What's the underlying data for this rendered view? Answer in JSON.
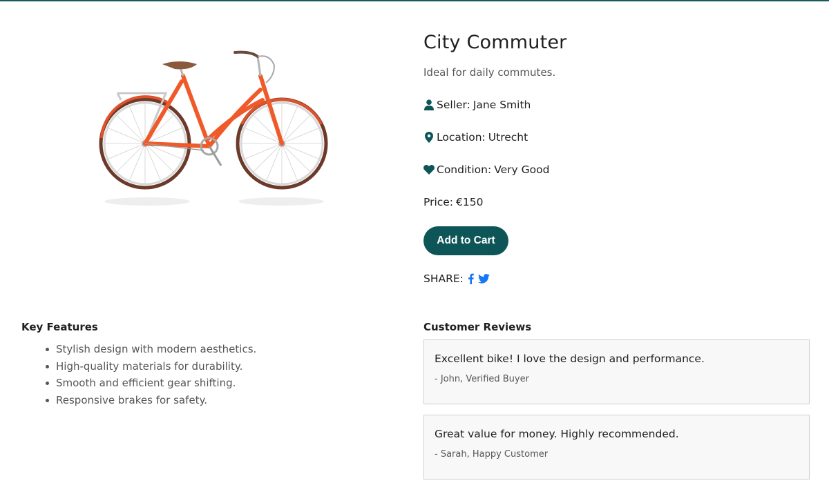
{
  "product": {
    "title": "City Commuter",
    "subtitle": "Ideal for daily commutes.",
    "seller_label": "Seller:",
    "seller_value": "Jane Smith",
    "location_label": "Location:",
    "location_value": "Utrecht",
    "condition_label": "Condition:",
    "condition_value": "Very Good",
    "price_label": "Price:",
    "price_value": "€150",
    "add_to_cart_label": "Add to Cart",
    "image_icon": "orange-city-bicycle-image"
  },
  "share": {
    "label": "SHARE:",
    "icons": [
      "facebook-icon",
      "twitter-icon"
    ]
  },
  "features": {
    "title": "Key Features",
    "items": [
      "Stylish design with modern aesthetics.",
      "High-quality materials for durability.",
      "Smooth and efficient gear shifting.",
      "Responsive brakes for safety."
    ]
  },
  "reviews": {
    "title": "Customer Reviews",
    "items": [
      {
        "text": "Excellent bike! I love the design and performance.",
        "author": "- John, Verified Buyer"
      },
      {
        "text": "Great value for money. Highly recommended.",
        "author": "- Sarah, Happy Customer"
      }
    ]
  },
  "colors": {
    "accent": "#0d5556",
    "top_rule": "#175a5b",
    "social_blue": "#1877f2",
    "bike_frame": "#f05a2a"
  }
}
